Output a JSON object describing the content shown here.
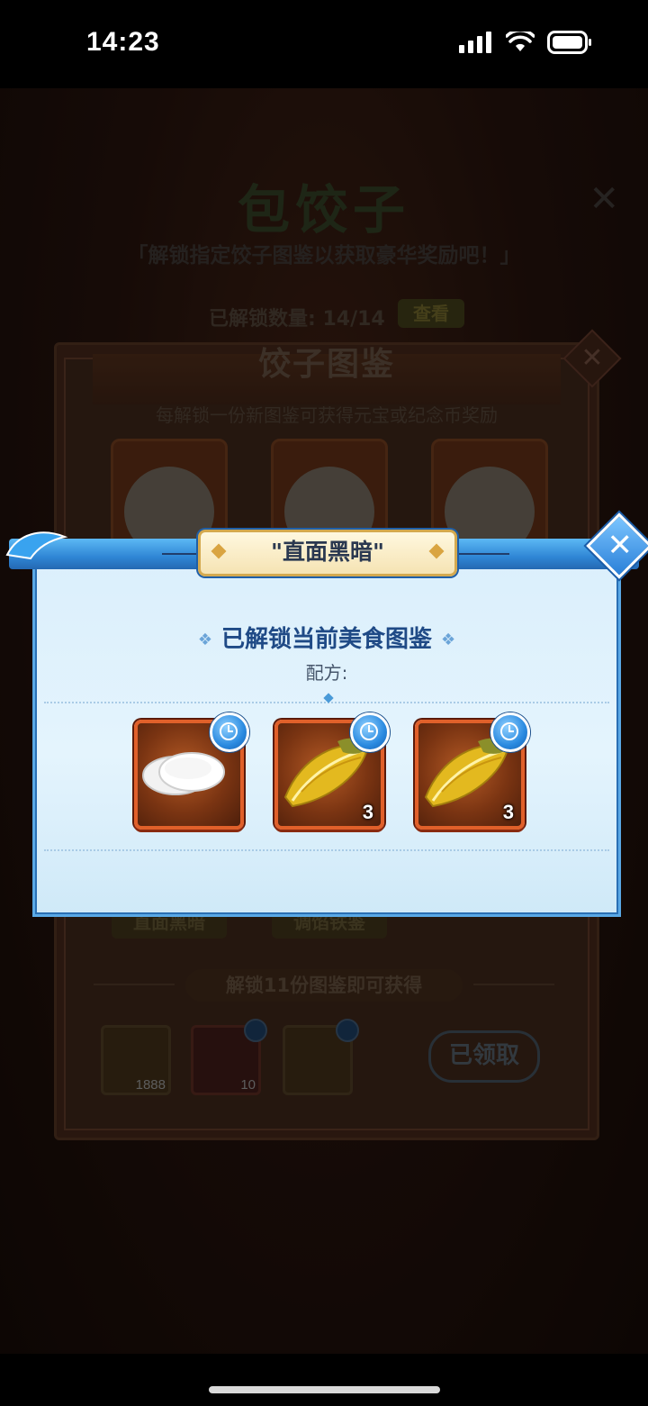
{
  "status_bar": {
    "time": "14:23"
  },
  "background": {
    "title": "包饺子",
    "subtitle": "「解锁指定饺子图鉴以获取豪华奖励吧！」",
    "unlock_count": "已解锁数量: 14/14",
    "check_button": "查看"
  },
  "collection_panel": {
    "title": "饺子图鉴",
    "description": "每解锁一份新图鉴可获得元宝或纪念币奖励",
    "dish_labels": [
      "直面黑暗",
      "调馅铁鉴"
    ],
    "reward_banner": "解锁11份图鉴即可获得",
    "rewards": [
      {
        "icon": "gold-ingot-icon",
        "count": "1888"
      },
      {
        "icon": "red-token-icon",
        "count": "10"
      },
      {
        "icon": "treasure-chest-icon",
        "count": ""
      }
    ],
    "claimed_button": "已领取"
  },
  "dialog": {
    "tab_title": "\"直面黑暗\"",
    "heading": "已解锁当前美食图鉴",
    "recipe_label": "配方:",
    "ingredients": [
      {
        "name": "dumpling-wrapper-icon",
        "qty": ""
      },
      {
        "name": "cabbage-icon",
        "qty": "3"
      },
      {
        "name": "cabbage-icon",
        "qty": "3"
      }
    ]
  },
  "colors": {
    "accent_blue": "#2f86d5",
    "item_border": "#e0602a",
    "dialog_bg": "#dbeffc"
  }
}
